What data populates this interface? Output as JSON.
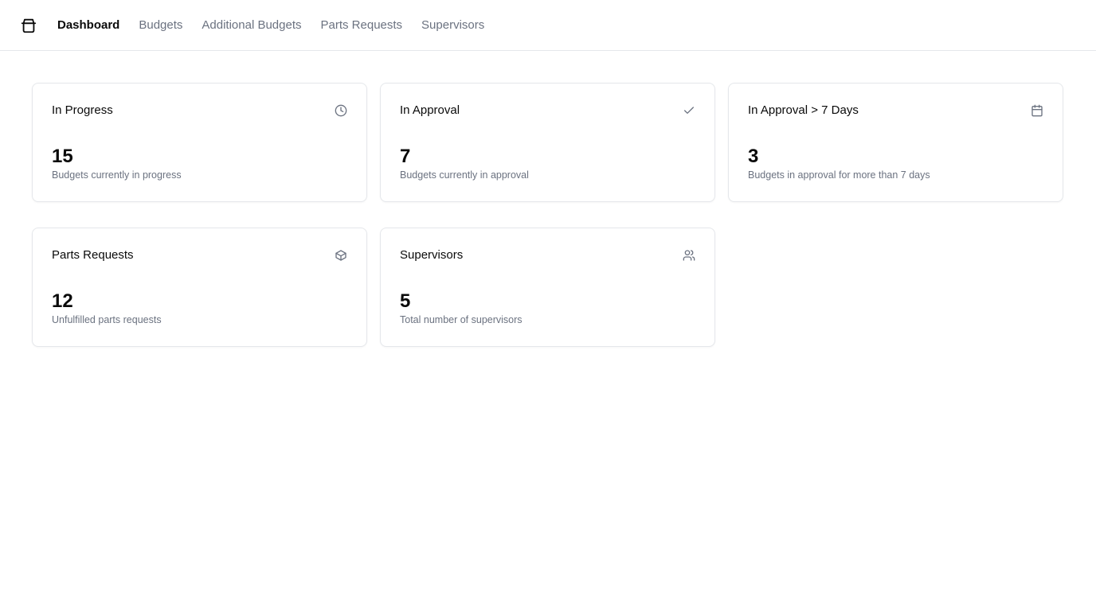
{
  "nav": {
    "logo_icon": "package-icon",
    "items": [
      {
        "label": "Dashboard",
        "active": true
      },
      {
        "label": "Budgets",
        "active": false
      },
      {
        "label": "Additional Budgets",
        "active": false
      },
      {
        "label": "Parts Requests",
        "active": false
      },
      {
        "label": "Supervisors",
        "active": false
      }
    ]
  },
  "cards": [
    {
      "title": "In Progress",
      "icon": "clock-icon",
      "value": "15",
      "description": "Budgets currently in progress"
    },
    {
      "title": "In Approval",
      "icon": "check-icon",
      "value": "7",
      "description": "Budgets currently in approval"
    },
    {
      "title": "In Approval > 7 Days",
      "icon": "calendar-icon",
      "value": "3",
      "description": "Budgets in approval for more than 7 days"
    },
    {
      "title": "Parts Requests",
      "icon": "box-icon",
      "value": "12",
      "description": "Unfulfilled parts requests"
    },
    {
      "title": "Supervisors",
      "icon": "users-icon",
      "value": "5",
      "description": "Total number of supervisors"
    }
  ],
  "colors": {
    "text_primary": "#0a0a0a",
    "text_muted": "#6b7280",
    "icon": "#6b7280",
    "border": "#e5e7eb"
  }
}
